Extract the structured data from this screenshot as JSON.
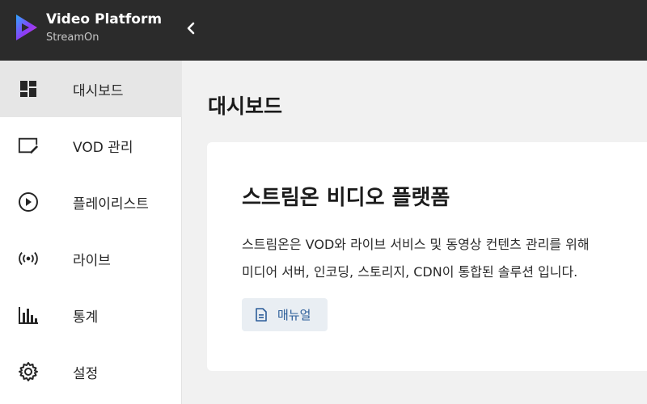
{
  "app": {
    "title": "Video Platform",
    "subtitle": "StreamOn",
    "colors": {
      "header_bg": "#2b2b2b",
      "logo_gradient": [
        "#2ea8ff",
        "#8b3cf6",
        "#d63bd0"
      ],
      "active_nav_bg": "#e6e6e6",
      "manual_button_bg": "#e9eef3",
      "manual_button_text": "#2c5d99"
    }
  },
  "header": {
    "collapse_icon": "chevron-left-icon"
  },
  "sidebar": {
    "items": [
      {
        "label": "대시보드",
        "icon": "dashboard-icon",
        "active": true
      },
      {
        "label": "VOD 관리",
        "icon": "edit-window-icon",
        "active": false
      },
      {
        "label": "플레이리스트",
        "icon": "play-circle-icon",
        "active": false
      },
      {
        "label": "라이브",
        "icon": "broadcast-icon",
        "active": false
      },
      {
        "label": "통계",
        "icon": "bar-chart-icon",
        "active": false
      },
      {
        "label": "설정",
        "icon": "gear-icon",
        "active": false
      }
    ]
  },
  "main": {
    "page_title": "대시보드",
    "card": {
      "title": "스트림온 비디오 플랫폼",
      "description_lines": [
        "스트림온은 VOD와 라이브 서비스 및 동영상 컨텐츠 관리를 위해",
        "미디어 서버, 인코딩, 스토리지, CDN이 통합된 솔루션 입니다."
      ],
      "manual_button": {
        "label": "매뉴얼",
        "icon": "document-icon"
      }
    }
  }
}
